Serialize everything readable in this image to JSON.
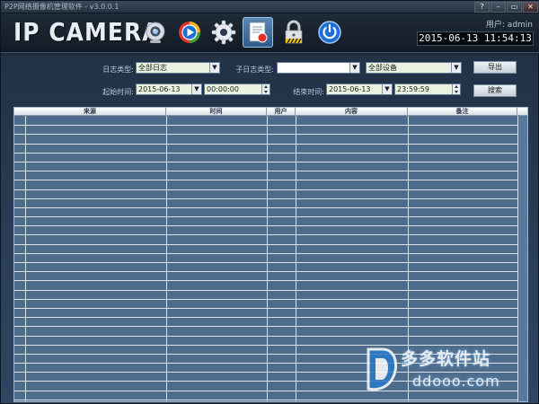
{
  "window": {
    "title": "P2P网络摄像机管理软件 - v3.0.0.1",
    "buttons": [
      "?",
      "–",
      "▭",
      "✕"
    ]
  },
  "header": {
    "brand": "IP CAMERA",
    "user_label": "用户: admin",
    "datetime": "2015-06-13 11:54:13",
    "toolbar_icons": [
      "camera-icon",
      "playback-icon",
      "settings-gear-icon",
      "log-icon",
      "lock-icon",
      "power-icon"
    ],
    "active_tool": "log-icon"
  },
  "filters": {
    "log_type_label": "日志类型:",
    "log_type_value": "全部日志",
    "sub_log_type_label": "子日志类型:",
    "sub_log_type_value": "",
    "device_value": "全部设备",
    "start_label": "起始时间:",
    "start_date": "2015-06-13",
    "start_time": "00:00:00",
    "end_label": "结束时间:",
    "end_date": "2015-06-13",
    "end_time": "23:59:59",
    "export_label": "导出",
    "search_label": "搜索"
  },
  "table": {
    "columns": [
      "来源",
      "时间",
      "用户",
      "内容",
      "备注"
    ],
    "rows": []
  },
  "watermark": {
    "site": "多多软件站",
    "url": "ddooo.com"
  },
  "colors": {
    "accent": "#5b87b5",
    "table_bg": "#4e6d8d",
    "grid_line": "#d6e1ec",
    "combo_bg": "#eaf3df"
  }
}
